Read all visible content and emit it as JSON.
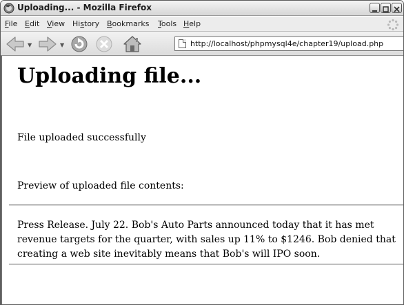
{
  "window": {
    "title": "Uploading... - Mozilla Firefox",
    "browser_icon": "firefox-icon"
  },
  "menu": {
    "items": [
      {
        "label": "File",
        "accel": "F",
        "rest": "ile"
      },
      {
        "label": "Edit",
        "accel": "E",
        "rest": "dit"
      },
      {
        "label": "View",
        "accel": "V",
        "rest": "iew"
      },
      {
        "label": "History",
        "pre": "Hi",
        "accel": "s",
        "rest": "tory"
      },
      {
        "label": "Bookmarks",
        "accel": "B",
        "rest": "ookmarks"
      },
      {
        "label": "Tools",
        "accel": "T",
        "rest": "ools"
      },
      {
        "label": "Help",
        "accel": "H",
        "rest": "elp"
      }
    ]
  },
  "toolbar": {
    "url": "http://localhost/phpmysql4e/chapter19/upload.php"
  },
  "page": {
    "heading": "Uploading file...",
    "status": "File uploaded successfully",
    "preview_label": "Preview of uploaded file contents:",
    "file_lines": [
      "Press Release. July 22. Bob's Auto Parts announced today that it has met",
      "revenue targets for the quarter, with sales up 11% to $1246. Bob denied that",
      "creating a web site inevitably means that Bob's will IPO soon."
    ]
  }
}
